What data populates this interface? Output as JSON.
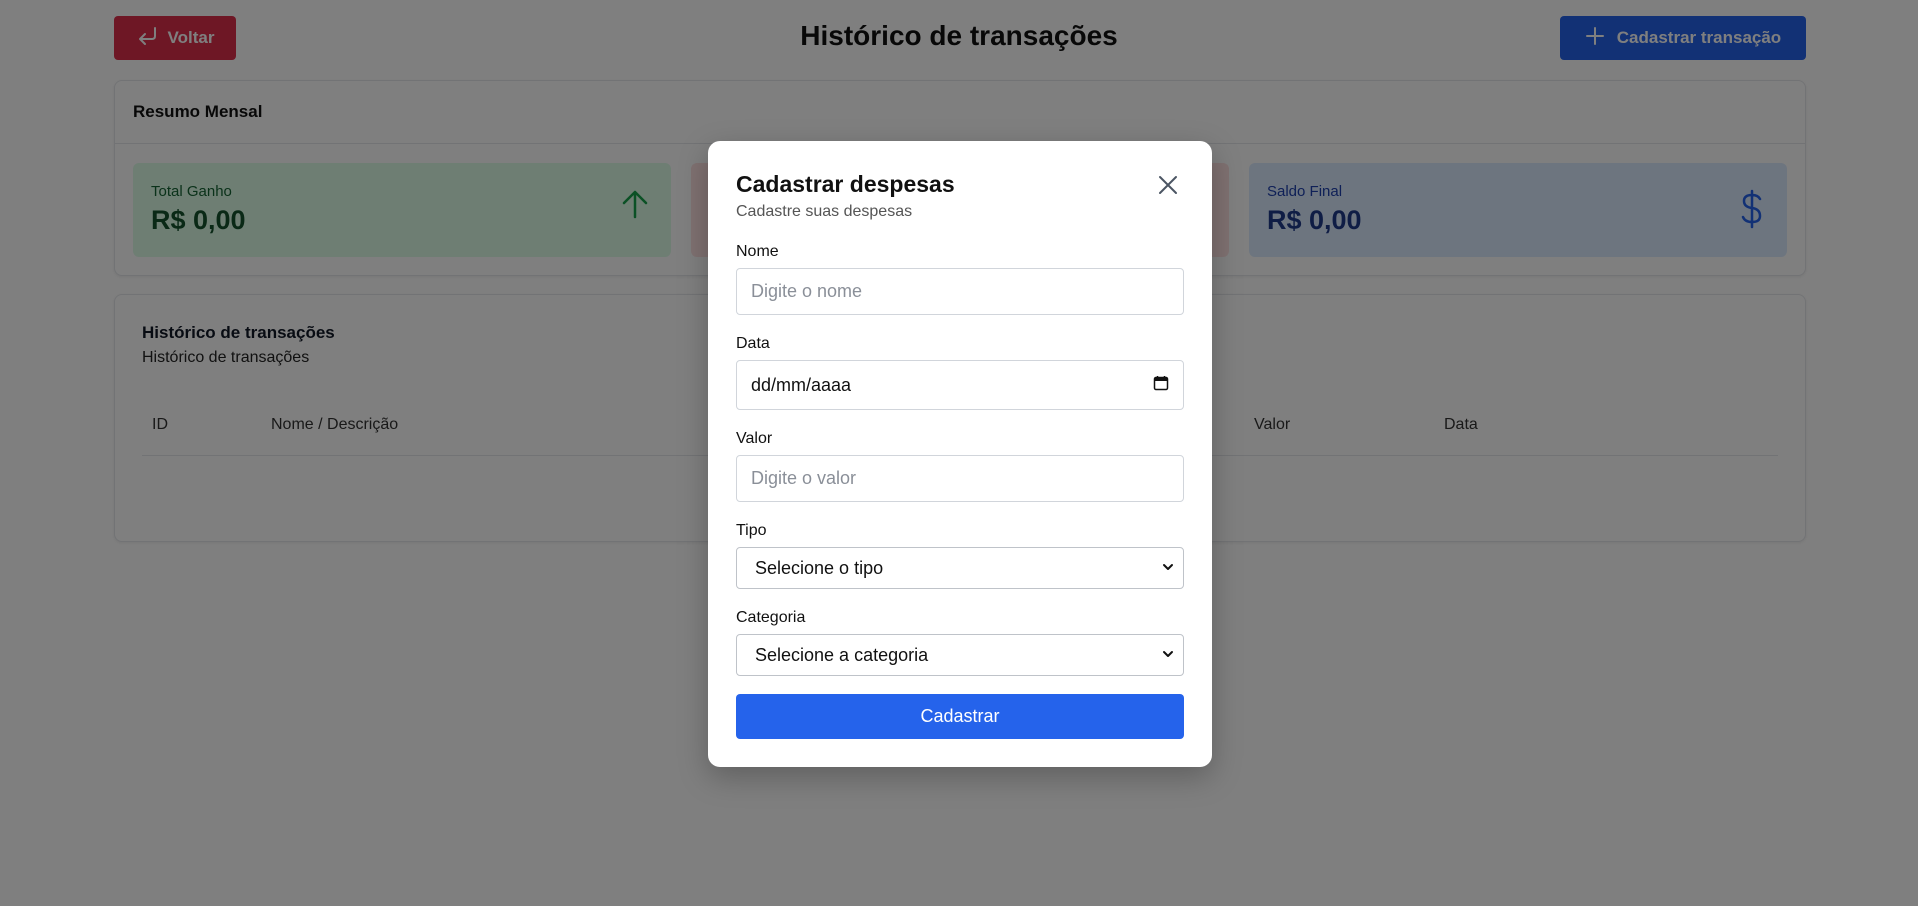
{
  "header": {
    "back_label": "Voltar",
    "title": "Histórico de transações",
    "add_label": "Cadastrar transação"
  },
  "summary": {
    "title": "Resumo Mensal",
    "cards": [
      {
        "label": "Total Ganho",
        "value": "R$ 0,00",
        "icon": "arrow-up-icon",
        "color": "#16a34a"
      },
      {
        "label": "",
        "value": "",
        "icon": "",
        "color": "#ef4444"
      },
      {
        "label": "Saldo Final",
        "value": "R$ 0,00",
        "icon": "dollar-icon",
        "color": "#2563eb"
      }
    ]
  },
  "history": {
    "title": "Histórico de transações",
    "subtitle": "Histórico de transações",
    "columns": [
      "ID",
      "Nome / Descrição",
      "Valor",
      "Data"
    ]
  },
  "modal": {
    "title": "Cadastrar despesas",
    "subtitle": "Cadastre suas despesas",
    "fields": {
      "nome": {
        "label": "Nome",
        "placeholder": "Digite o nome"
      },
      "data": {
        "label": "Data",
        "value": "dd/mm/aaaa"
      },
      "valor": {
        "label": "Valor",
        "placeholder": "Digite o valor"
      },
      "tipo": {
        "label": "Tipo",
        "selected": "Selecione o tipo"
      },
      "categoria": {
        "label": "Categoria",
        "selected": "Selecione a categoria"
      }
    },
    "submit_label": "Cadastrar"
  },
  "colors": {
    "primary": "#2563eb",
    "danger": "#dc2f4b",
    "overlay": "rgba(0,0,0,0.5)"
  }
}
